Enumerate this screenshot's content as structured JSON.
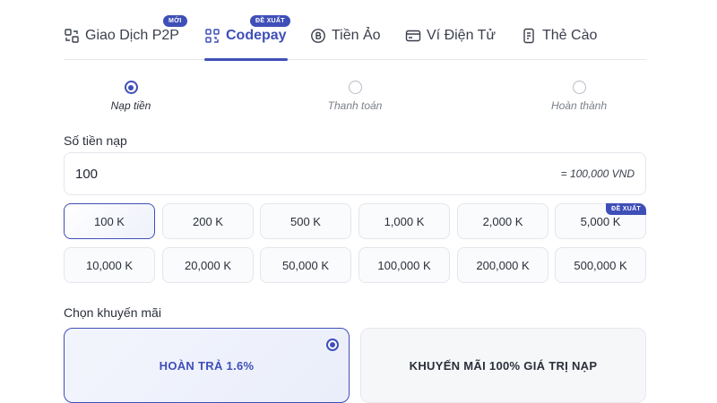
{
  "tabs": [
    {
      "label": "Giao Dịch P2P",
      "icon": "p2p-exchange-icon",
      "badge": "MỚI"
    },
    {
      "label": "Codepay",
      "icon": "qr-scan-icon",
      "badge": "ĐỀ XUẤT",
      "active": true
    },
    {
      "label": "Tiền Ảo",
      "icon": "bitcoin-icon",
      "badge": ""
    },
    {
      "label": "Ví Điện Tử",
      "icon": "wallet-icon",
      "badge": ""
    },
    {
      "label": "Thẻ Cào",
      "icon": "scratch-card-icon",
      "badge": ""
    }
  ],
  "steps": [
    {
      "label": "Nạp tiền",
      "active": true
    },
    {
      "label": "Thanh toán",
      "active": false
    },
    {
      "label": "Hoàn thành",
      "active": false
    }
  ],
  "amount": {
    "label": "Số tiền nạp",
    "value": "100",
    "converted": "= 100,000 VND"
  },
  "presets": [
    {
      "label": "100 K",
      "selected": true,
      "badge": ""
    },
    {
      "label": "200 K",
      "badge": ""
    },
    {
      "label": "500 K",
      "badge": ""
    },
    {
      "label": "1,000 K",
      "badge": ""
    },
    {
      "label": "2,000 K",
      "badge": ""
    },
    {
      "label": "5,000 K",
      "badge": "ĐỀ XUẤT"
    },
    {
      "label": "10,000 K",
      "badge": ""
    },
    {
      "label": "20,000 K",
      "badge": ""
    },
    {
      "label": "50,000 K",
      "badge": ""
    },
    {
      "label": "100,000 K",
      "badge": ""
    },
    {
      "label": "200,000 K",
      "badge": ""
    },
    {
      "label": "500,000 K",
      "badge": ""
    }
  ],
  "promo": {
    "label": "Chọn khuyến mãi",
    "options": [
      {
        "label": "HOÀN TRẢ 1.6%",
        "selected": true
      },
      {
        "label": "KHUYẾN MÃI 100% GIÁ TRỊ NẠP",
        "selected": false
      }
    ]
  },
  "colors": {
    "accent": "#3f4fb8",
    "border": "#e3e6ec",
    "text": "#2a2f3a"
  }
}
